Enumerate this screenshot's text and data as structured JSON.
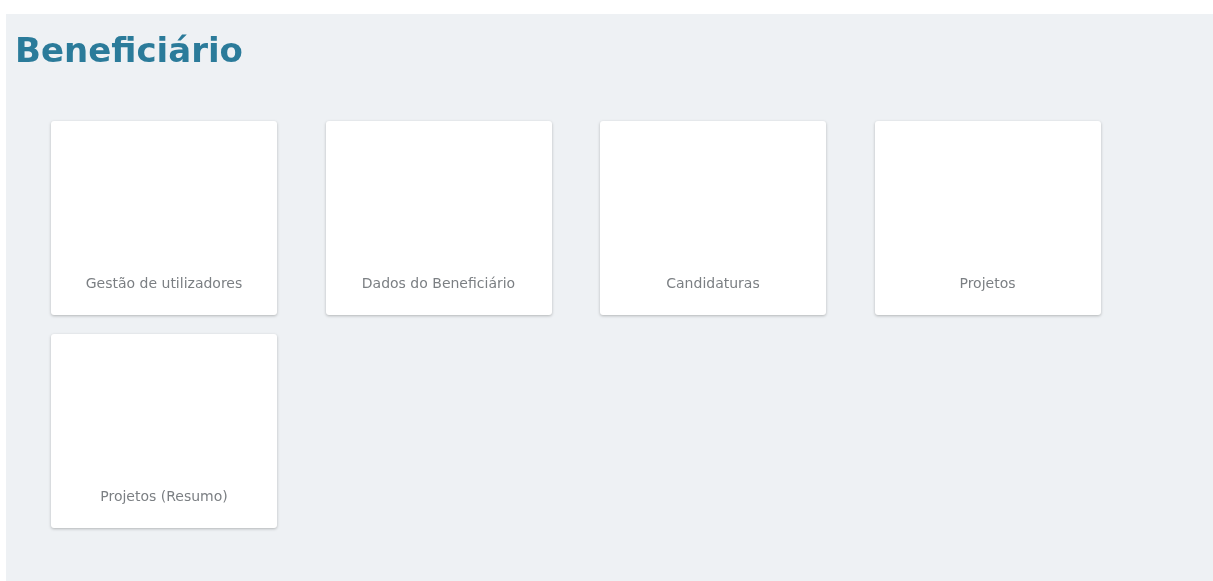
{
  "page": {
    "title": "Beneficiário"
  },
  "tiles": [
    {
      "label": "Gestão de utilizadores"
    },
    {
      "label": "Dados do Beneficiário"
    },
    {
      "label": "Candidaturas"
    },
    {
      "label": "Projetos"
    },
    {
      "label": "Projetos (Resumo)"
    }
  ]
}
